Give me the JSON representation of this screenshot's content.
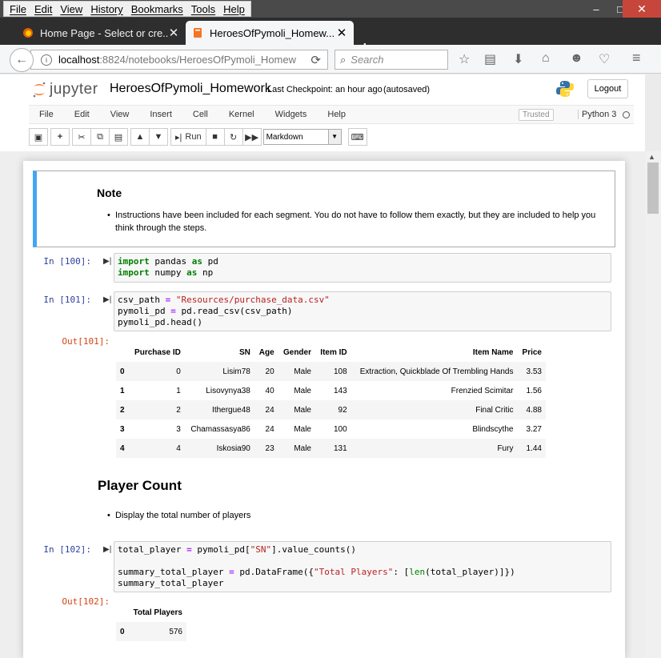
{
  "browser": {
    "menu": [
      "File",
      "Edit",
      "View",
      "History",
      "Bookmarks",
      "Tools",
      "Help"
    ],
    "window_controls": {
      "minimize": "–",
      "maximize": "□",
      "close": "✕"
    },
    "tabs": [
      {
        "label": "Home Page - Select or cre...",
        "icon": "firefox-icon"
      },
      {
        "label": "HeroesOfPymoli_Homew...",
        "icon": "notebook-icon"
      }
    ],
    "new_tab": "+",
    "url_host": "localhost",
    "url_rest": ":8824/notebooks/HeroesOfPymoli_Homew",
    "search_placeholder": "Search"
  },
  "jupyter": {
    "logo_text": "jupyter",
    "notebook_title": "HeroesOfPymoli_Homework",
    "checkpoint": "Last Checkpoint: an hour ago",
    "autosave": "(autosaved)",
    "logout": "Logout",
    "menu": [
      "File",
      "Edit",
      "View",
      "Insert",
      "Cell",
      "Kernel",
      "Widgets",
      "Help"
    ],
    "trusted": "Trusted",
    "kernel": "Python 3",
    "toolbar": {
      "run_label": "Run",
      "cell_type": "Markdown"
    }
  },
  "cells": {
    "note": {
      "heading": "Note",
      "bullet": "Instructions have been included for each segment. You do not have to follow them exactly, but they are included to help you",
      "bullet_cont": "think through the steps."
    },
    "in100": {
      "prompt": "In [100]:"
    },
    "in101": {
      "prompt": "In [101]:"
    },
    "out101": {
      "prompt": "Out[101]:",
      "columns": [
        "Purchase ID",
        "SN",
        "Age",
        "Gender",
        "Item ID",
        "Item Name",
        "Price"
      ],
      "rows": [
        [
          "0",
          "0",
          "Lisim78",
          "20",
          "Male",
          "108",
          "Extraction, Quickblade Of Trembling Hands",
          "3.53"
        ],
        [
          "1",
          "1",
          "Lisovynya38",
          "40",
          "Male",
          "143",
          "Frenzied Scimitar",
          "1.56"
        ],
        [
          "2",
          "2",
          "Ithergue48",
          "24",
          "Male",
          "92",
          "Final Critic",
          "4.88"
        ],
        [
          "3",
          "3",
          "Chamassasya86",
          "24",
          "Male",
          "100",
          "Blindscythe",
          "3.27"
        ],
        [
          "4",
          "4",
          "Iskosia90",
          "23",
          "Male",
          "131",
          "Fury",
          "1.44"
        ]
      ]
    },
    "player_count": {
      "heading": "Player Count",
      "bullet": "Display the total number of players"
    },
    "in102": {
      "prompt": "In [102]:"
    },
    "out102": {
      "prompt": "Out[102]:",
      "column": "Total Players",
      "row_index": "0",
      "value": "576"
    }
  }
}
